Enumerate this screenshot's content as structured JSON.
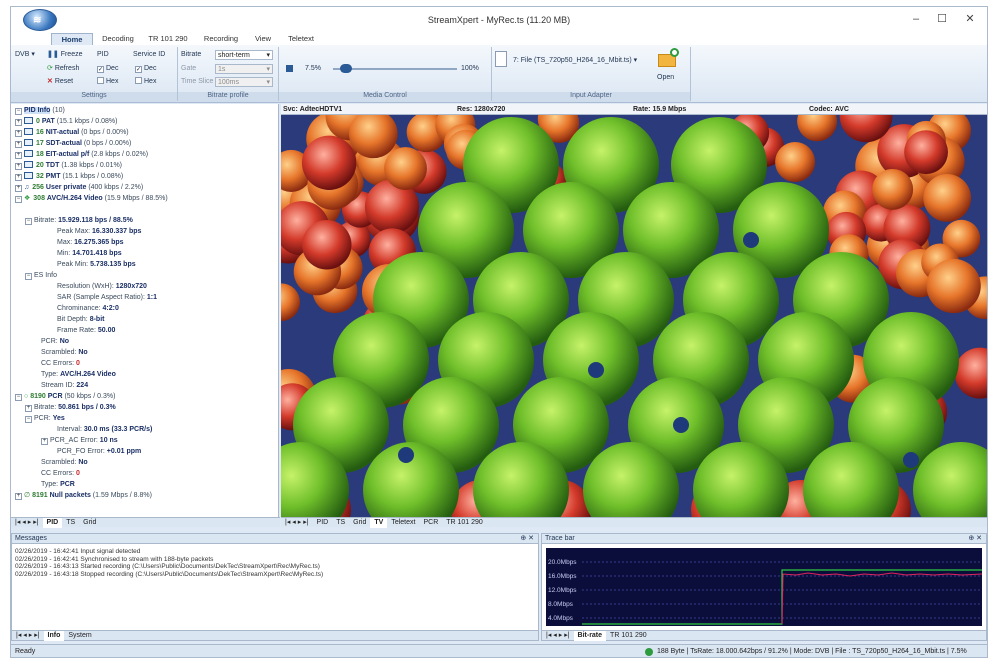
{
  "window": {
    "title": "StreamXpert - MyRec.ts (11.20 MB)",
    "minimize": "–",
    "maximize": "☐",
    "close": "✕"
  },
  "tabs": [
    "Home",
    "Decoding",
    "TR 101 290",
    "Recording",
    "View",
    "Teletext"
  ],
  "ribbon": {
    "dvb": "DVB",
    "freeze": "Freeze",
    "refresh": "Refresh",
    "reset": "Reset",
    "pid": "PID",
    "service_id": "Service ID",
    "dec": "Dec",
    "hex": "Hex",
    "bitrate": "Bitrate",
    "gate": "Gate",
    "time_slice": "Time Slice",
    "bitrate_val": "short-term",
    "gate_val": "1s",
    "time_slice_val": "100ms",
    "media_min": "7.5%",
    "media_max": "100%",
    "media_pos": 0.07,
    "file": "7: File (TS_720p50_H264_16_Mbit.ts)",
    "open": "Open",
    "groups": [
      "Settings",
      "Bitrate profile",
      "Media Control",
      "Input Adapter"
    ]
  },
  "tree": {
    "root": "PID Info",
    "root_count": "(10)",
    "pids": [
      {
        "num": "0",
        "name": "PAT",
        "rate": "(15.1 kbps / 0.08%)"
      },
      {
        "num": "16",
        "name": "NIT-actual",
        "rate": "(0 bps / 0.00%)"
      },
      {
        "num": "17",
        "name": "SDT-actual",
        "rate": "(0 bps / 0.00%)"
      },
      {
        "num": "18",
        "name": "EIT-actual p/f",
        "rate": "(2.8 kbps / 0.02%)"
      },
      {
        "num": "20",
        "name": "TDT",
        "rate": "(1.38 kbps / 0.01%)"
      },
      {
        "num": "32",
        "name": "PMT",
        "rate": "(15.1 kbps / 0.08%)"
      },
      {
        "num": "256",
        "name": "User private",
        "rate": "(400 kbps / 2.2%)"
      },
      {
        "num": "308",
        "name": "AVC/H.264 Video",
        "rate": "(15.9 Mbps / 88.5%)"
      }
    ],
    "video": {
      "bitrate_l": "Bitrate:",
      "bitrate": "15.929.118 bps / 88.5%",
      "peakmax_l": "Peak Max:",
      "peakmax": "16.330.337 bps",
      "max_l": "Max:",
      "max": "16.275.365 bps",
      "min_l": "Min:",
      "min": "14.701.418 bps",
      "peakmin_l": "Peak Min:",
      "peakmin": "5.738.135 bps",
      "es": "ES Info",
      "res_l": "Resolution (WxH):",
      "res": "1280x720",
      "sar_l": "SAR (Sample Aspect Ratio):",
      "sar": "1:1",
      "chroma_l": "Chrominance:",
      "chroma": "4:2:0",
      "depth_l": "Bit Depth:",
      "depth": "8-bit",
      "fr_l": "Frame Rate:",
      "fr": "50.00",
      "pcr_l": "PCR:",
      "pcr": "No",
      "scr_l": "Scrambled:",
      "scr": "No",
      "cc_l": "CC Errors:",
      "cc": "0",
      "type_l": "Type:",
      "type": "AVC/H.264 Video",
      "sid_l": "Stream ID:",
      "sid": "224"
    },
    "pcr": {
      "num": "8190",
      "name": "PCR",
      "rate": "(50 kbps / 0.3%)",
      "bitrate_l": "Bitrate:",
      "bitrate": "50.861 bps / 0.3%",
      "pcr_l": "PCR:",
      "pcr": "Yes",
      "int_l": "Interval:",
      "int": "30.0 ms (33.3 PCR/s)",
      "ac_l": "PCR_AC Error:",
      "ac": "10 ns",
      "fo_l": "PCR_FO Error:",
      "fo": "+0.01 ppm",
      "scr_l": "Scrambled:",
      "scr": "No",
      "cc_l": "CC Errors:",
      "cc": "0",
      "type_l": "Type:",
      "type": "PCR"
    },
    "null": {
      "num": "8191",
      "name": "Null packets",
      "rate": "(1.59 Mbps / 8.8%)"
    }
  },
  "left_tabs": [
    "PID",
    "TS",
    "Grid"
  ],
  "video_header": {
    "svc_l": "Svc:",
    "svc": "AdtecHDTV1",
    "res_l": "Res:",
    "res": "1280x720",
    "rate_l": "Rate:",
    "rate": "15.9 Mbps",
    "codec_l": "Codec:",
    "codec": "AVC"
  },
  "video_tabs": [
    "PID",
    "TS",
    "Grid",
    "TV",
    "Teletext",
    "PCR",
    "TR 101 290"
  ],
  "messages": {
    "title": "Messages",
    "lines": [
      "02/26/2019 - 16:42:41 Input signal detected",
      "02/26/2019 - 16:42:41 Synchronised to stream with 188-byte packets",
      "02/26/2019 - 16:43:13 Started recording (C:\\Users\\Public\\Documents\\DekTec\\StreamXpert\\Rec\\MyRec.ts)",
      "02/26/2019 - 16:43:18 Stopped recording (C:\\Users\\Public\\Documents\\DekTec\\StreamXpert\\Rec\\MyRec.ts)"
    ],
    "tabs": [
      "Info",
      "System"
    ]
  },
  "trace": {
    "title": "Trace bar",
    "ylabels": [
      "20.0Mbps",
      "16.0Mbps",
      "12.0Mbps",
      "8.0Mbps",
      "4.0Mbps"
    ],
    "tabs": [
      "Bit-rate",
      "TR 101 290"
    ]
  },
  "status": {
    "left": "Ready",
    "right": "188 Byte | TsRate: 18.000.642bps / 91.2% | Mode: DVB | File : TS_720p50_H264_16_Mbit.ts | 7.5%"
  },
  "colors": {
    "accent": "#2a5b96",
    "good": "#2e9b3e",
    "error": "#c62828"
  }
}
